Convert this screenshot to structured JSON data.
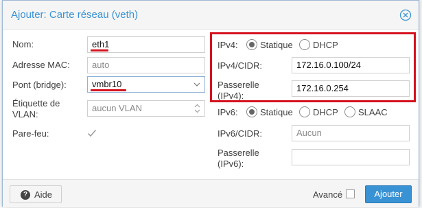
{
  "dialog": {
    "title": "Ajouter: Carte réseau (veth)"
  },
  "left": {
    "name_label": "Nom:",
    "name_value": "eth1",
    "mac_label": "Adresse MAC:",
    "mac_value": "auto",
    "bridge_label": "Pont (bridge):",
    "bridge_value": "vmbr10",
    "vlan_label_1": "Étiquette de",
    "vlan_label_2": "VLAN:",
    "vlan_value": "aucun VLAN",
    "firewall_label": "Pare-feu:",
    "firewall_checked": true
  },
  "ipv4": {
    "label": "IPv4:",
    "static_label": "Statique",
    "dhcp_label": "DHCP",
    "mode": "Statique",
    "cidr_label": "IPv4/CIDR:",
    "cidr_value": "172.16.0.100/24",
    "gw_label_1": "Passerelle",
    "gw_label_2": "(IPv4):",
    "gw_value": "172.16.0.254"
  },
  "ipv6": {
    "label": "IPv6:",
    "static_label": "Statique",
    "dhcp_label": "DHCP",
    "slaac_label": "SLAAC",
    "mode": "Statique",
    "cidr_label": "IPv6/CIDR:",
    "cidr_placeholder": "Aucun",
    "gw_label_1": "Passerelle",
    "gw_label_2": "(IPv6):",
    "gw_value": ""
  },
  "footer": {
    "help_label": "Aide",
    "advanced_label": "Avancé",
    "advanced_checked": false,
    "add_label": "Ajouter"
  },
  "colors": {
    "accent": "#3892d4",
    "highlight": "#d4121e"
  }
}
